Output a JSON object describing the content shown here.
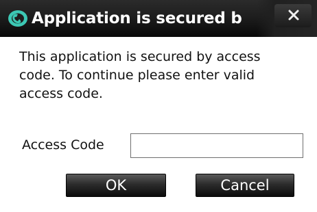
{
  "window": {
    "title": "Application is secured b",
    "icon": "app-logo-icon",
    "close_icon": "close-icon"
  },
  "message": {
    "lines": [
      "This application is secured by access",
      "code. To continue please enter valid",
      "access code."
    ]
  },
  "form": {
    "access_code_label": "Access Code",
    "access_code_value": ""
  },
  "buttons": {
    "ok_label": "OK",
    "cancel_label": "Cancel"
  },
  "colors": {
    "titlebar": "#1e1e1e",
    "title_text": "#ffffff",
    "icon_accent": "#3cc8b4",
    "button_bg": "#2c2c2c"
  }
}
